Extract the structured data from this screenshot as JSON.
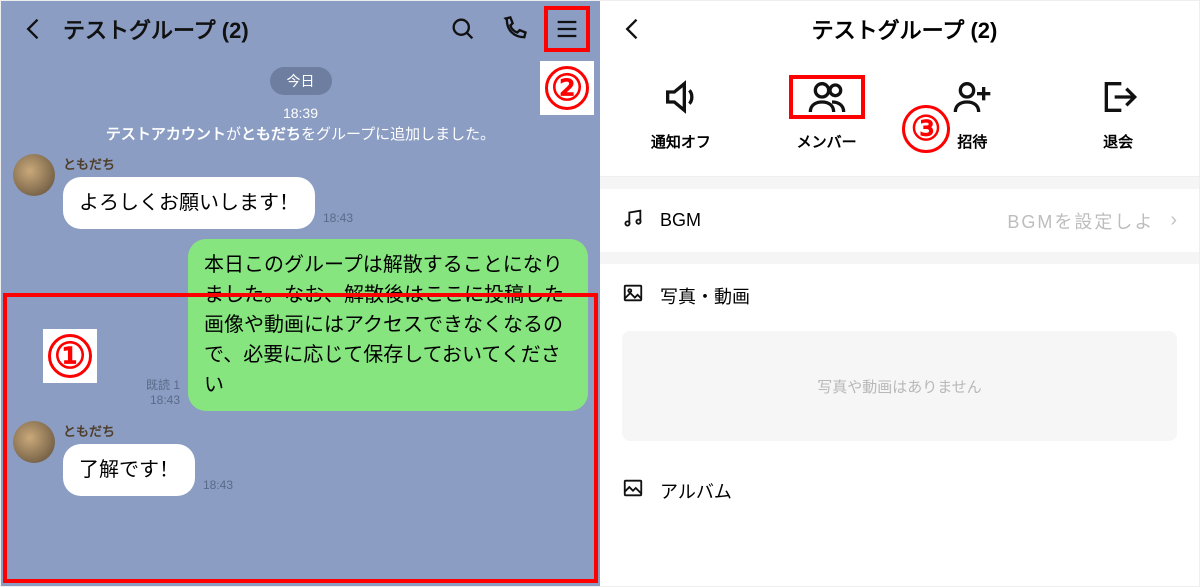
{
  "left": {
    "title": "テストグループ (2)",
    "date_label": "今日",
    "system": {
      "time": "18:39",
      "actor": "テストアカウント",
      "middle": "が",
      "target": "ともだち",
      "tail": "をグループに追加しました。"
    },
    "msg1": {
      "name": "ともだち",
      "text": "よろしくお願いします！",
      "time": "18:43"
    },
    "mine": {
      "text": "本日このグループは解散することになりました。なお、解散後はここに投稿した画像や動画にはアクセスできなくなるので、必要に応じて保存しておいてください",
      "read": "既読 1",
      "time": "18:43"
    },
    "msg2": {
      "name": "ともだち",
      "text": "了解です！",
      "time": "18:43"
    },
    "annot1": "①",
    "annot2": "②"
  },
  "right": {
    "title": "テストグループ (2)",
    "actions": {
      "mute": "通知オフ",
      "members": "メンバー",
      "invite": "招待",
      "leave": "退会"
    },
    "annot3": "③",
    "bgm": {
      "label": "BGM",
      "value": "BGMを設定しよ"
    },
    "media": {
      "label": "写真・動画",
      "empty": "写真や動画はありません"
    },
    "album": {
      "label": "アルバム"
    }
  }
}
